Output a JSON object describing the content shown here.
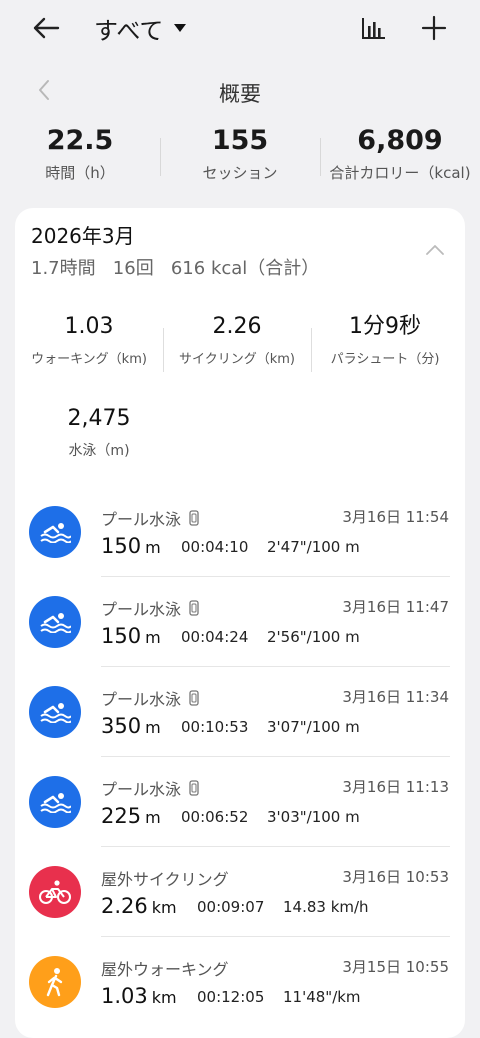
{
  "header": {
    "filter_label": "すべて"
  },
  "period": {
    "title": "概要"
  },
  "totals": [
    {
      "value": "22.5",
      "label": "時間（h）"
    },
    {
      "value": "155",
      "label": "セッション"
    },
    {
      "value": "6,809",
      "label": "合計カロリー（kcal)"
    }
  ],
  "month": {
    "title": "2026年3月",
    "summary": "1.7時間   16回   616 kcal（合計）",
    "metrics": [
      {
        "value": "1.03",
        "label": "ウォーキング（km)"
      },
      {
        "value": "2.26",
        "label": "サイクリング（km)"
      },
      {
        "value": "1分9秒",
        "label": "パラシュート（分)"
      }
    ],
    "swim_metric": {
      "value": "2,475",
      "label": "水泳（m)"
    }
  },
  "sessions": [
    {
      "type": "swim",
      "name": "プール水泳",
      "datetime": "3月16日 11:54",
      "distance": "150",
      "unit": "m",
      "duration": "00:04:10",
      "pace": "2'47\"/100 m"
    },
    {
      "type": "swim",
      "name": "プール水泳",
      "datetime": "3月16日 11:47",
      "distance": "150",
      "unit": "m",
      "duration": "00:04:24",
      "pace": "2'56\"/100 m"
    },
    {
      "type": "swim",
      "name": "プール水泳",
      "datetime": "3月16日 11:34",
      "distance": "350",
      "unit": "m",
      "duration": "00:10:53",
      "pace": "3'07\"/100 m"
    },
    {
      "type": "swim",
      "name": "プール水泳",
      "datetime": "3月16日 11:13",
      "distance": "225",
      "unit": "m",
      "duration": "00:06:52",
      "pace": "3'03\"/100 m"
    },
    {
      "type": "cycle",
      "name": "屋外サイクリング",
      "datetime": "3月16日 10:53",
      "distance": "2.26",
      "unit": "km",
      "duration": "00:09:07",
      "pace": "14.83 km/h"
    },
    {
      "type": "walk",
      "name": "屋外ウォーキング",
      "datetime": "3月15日 10:55",
      "distance": "1.03",
      "unit": "km",
      "duration": "00:12:05",
      "pace": "11'48\"/km"
    }
  ],
  "colors": {
    "swim": "#1e6fe8",
    "cycle": "#e8304d",
    "walk": "#ff9f1a",
    "background": "#f1f1f3"
  },
  "icons": {
    "back": "arrow-left-icon",
    "dropdown": "triangle-down-icon",
    "stats": "bar-chart-icon",
    "add": "plus-icon",
    "prev": "chevron-left-icon",
    "collapse": "chevron-up-icon",
    "device": "watch-icon",
    "swim": "swimmer-icon",
    "cycle": "cyclist-icon",
    "walk": "walker-icon"
  }
}
